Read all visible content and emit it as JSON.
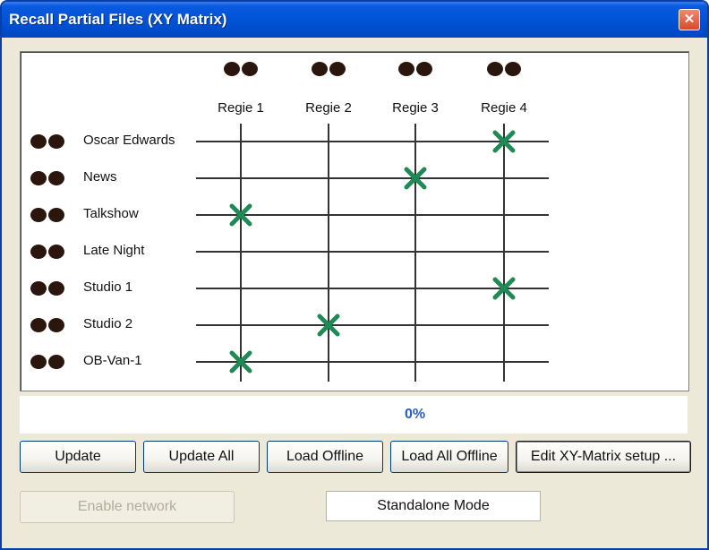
{
  "window": {
    "title": "Recall Partial Files (XY Matrix)",
    "close_icon": "close-icon",
    "close_glyph": "✕"
  },
  "matrix": {
    "columns": [
      "Regie 1",
      "Regie 2",
      "Regie 3",
      "Regie 4"
    ],
    "rows": [
      "Oscar Edwards",
      "News",
      "Talkshow",
      "Late Night",
      "Studio 1",
      "Studio 2",
      "OB-Van-1"
    ],
    "connections": [
      {
        "row": "Oscar Edwards",
        "column": "Regie 4"
      },
      {
        "row": "News",
        "column": "Regie 3"
      },
      {
        "row": "Talkshow",
        "column": "Regie 1"
      },
      {
        "row": "Studio 1",
        "column": "Regie 4"
      },
      {
        "row": "Studio 2",
        "column": "Regie 2"
      },
      {
        "row": "OB-Van-1",
        "column": "Regie 1"
      }
    ],
    "indicator_icon": "dual-led-indicator-icon",
    "connection_icon": "x-mark-icon",
    "colors": {
      "led": "#2a160c",
      "grid_line": "#333333",
      "connection_mark": "#1f8a55"
    }
  },
  "status": {
    "progress": "0%"
  },
  "buttons": {
    "update": "Update",
    "update_all": "Update All",
    "load_offline": "Load Offline",
    "load_all_offline": "Load All Offline",
    "edit_setup": "Edit XY-Matrix setup ...",
    "enable_network": "Enable network"
  },
  "mode": {
    "label": "Standalone Mode"
  }
}
